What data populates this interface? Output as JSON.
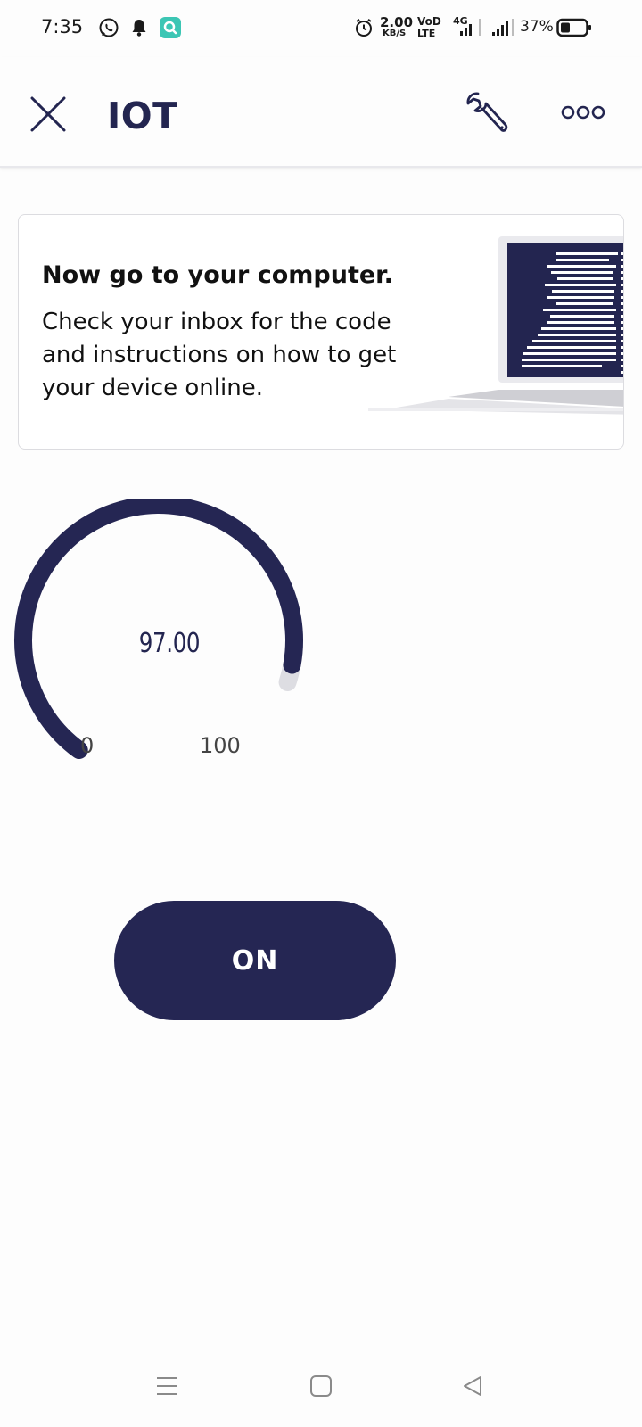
{
  "status_bar": {
    "time": "7:35",
    "net_speed_value": "2.00",
    "net_speed_unit": "KB/S",
    "volte_top": "VoD",
    "volte_bottom": "LTE",
    "network_type": "4G",
    "battery_percent": "37%",
    "battery_level": 0.37,
    "icons": [
      "whatsapp-icon",
      "notification-bell-icon",
      "app-notification-icon",
      "alarm-icon",
      "signal-icon",
      "battery-icon"
    ]
  },
  "app_bar": {
    "title": "IOT",
    "close_icon": "close-icon",
    "settings_icon": "wrench-icon",
    "more_icon": "more-horizontal-icon"
  },
  "notice": {
    "title": "Now go to your computer.",
    "body": "Check your inbox for the code and instructions on how to get your device online.",
    "illustration": "laptop-code-illustration"
  },
  "gauge": {
    "value": "97.00",
    "min": "0",
    "max": "100",
    "fill_fraction": 0.97,
    "color": "#252653",
    "track_color": "#dddde2"
  },
  "switch_button": {
    "label": "ON",
    "color": "#252653"
  },
  "nav_bar": {
    "icons": [
      "menu-icon",
      "home-square-icon",
      "back-triangle-icon"
    ]
  },
  "colors": {
    "brand": "#232550",
    "background": "#fdfdfd"
  }
}
